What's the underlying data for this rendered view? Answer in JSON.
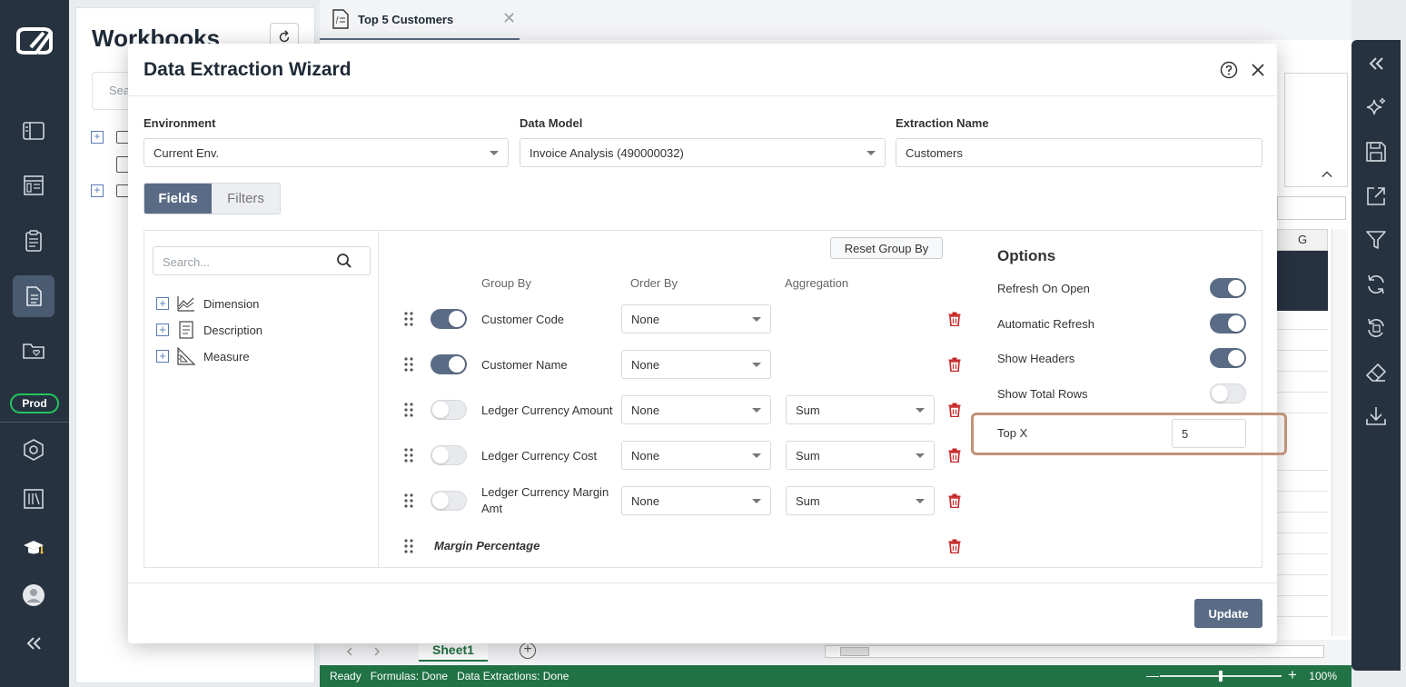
{
  "nav": {
    "env_badge": "Prod"
  },
  "workbooks": {
    "title": "Workbooks",
    "search_placeholder": "Sea"
  },
  "doc_tab": {
    "label": "Top 5 Customers",
    "close": "✕"
  },
  "sheet": {
    "column_g": "G",
    "sheet_tab": "Sheet1",
    "status": {
      "ready": "Ready",
      "formulas": "Formulas: Done",
      "extractions": "Data Extractions: Done",
      "zoom": "100%"
    }
  },
  "modal": {
    "title": "Data Extraction Wizard",
    "environment_label": "Environment",
    "environment_value": "Current Env.",
    "data_model_label": "Data Model",
    "data_model_value": "Invoice Analysis (490000032)",
    "extraction_name_label": "Extraction Name",
    "extraction_name_value": "Customers",
    "tabs": {
      "fields": "Fields",
      "filters": "Filters"
    },
    "search_placeholder": "Search...",
    "tree": [
      {
        "label": "Dimension",
        "icon": "line-chart-icon"
      },
      {
        "label": "Description",
        "icon": "document-icon"
      },
      {
        "label": "Measure",
        "icon": "ruler-triangle-icon"
      }
    ],
    "reset_group_by": "Reset Group By",
    "columns": {
      "group_by": "Group By",
      "order_by": "Order By",
      "aggregation": "Aggregation"
    },
    "fields": [
      {
        "name": "Customer Code",
        "group_by": true,
        "order_by": "None",
        "aggregation": ""
      },
      {
        "name": "Customer Name",
        "group_by": true,
        "order_by": "None",
        "aggregation": ""
      },
      {
        "name": "Ledger Currency Amount",
        "group_by": false,
        "order_by": "None",
        "aggregation": "Sum"
      },
      {
        "name": "Ledger Currency Cost",
        "group_by": false,
        "order_by": "None",
        "aggregation": "Sum"
      },
      {
        "name": "Ledger Currency Margin Amt",
        "group_by": false,
        "order_by": "None",
        "aggregation": "Sum"
      },
      {
        "name": "Margin Percentage",
        "group_by": null,
        "order_by": "",
        "aggregation": ""
      }
    ],
    "options": {
      "title": "Options",
      "items": [
        {
          "label": "Refresh On Open",
          "on": true
        },
        {
          "label": "Automatic Refresh",
          "on": true
        },
        {
          "label": "Show Headers",
          "on": true
        },
        {
          "label": "Show Total Rows",
          "on": false
        }
      ],
      "top_x_label": "Top X",
      "top_x_value": "5"
    },
    "update": "Update"
  },
  "colors": {
    "nav_bg": "#26323f",
    "accent": "#5a6b86",
    "status_green": "#217346",
    "delete_red": "#c62828",
    "highlight": "#c0927a"
  }
}
